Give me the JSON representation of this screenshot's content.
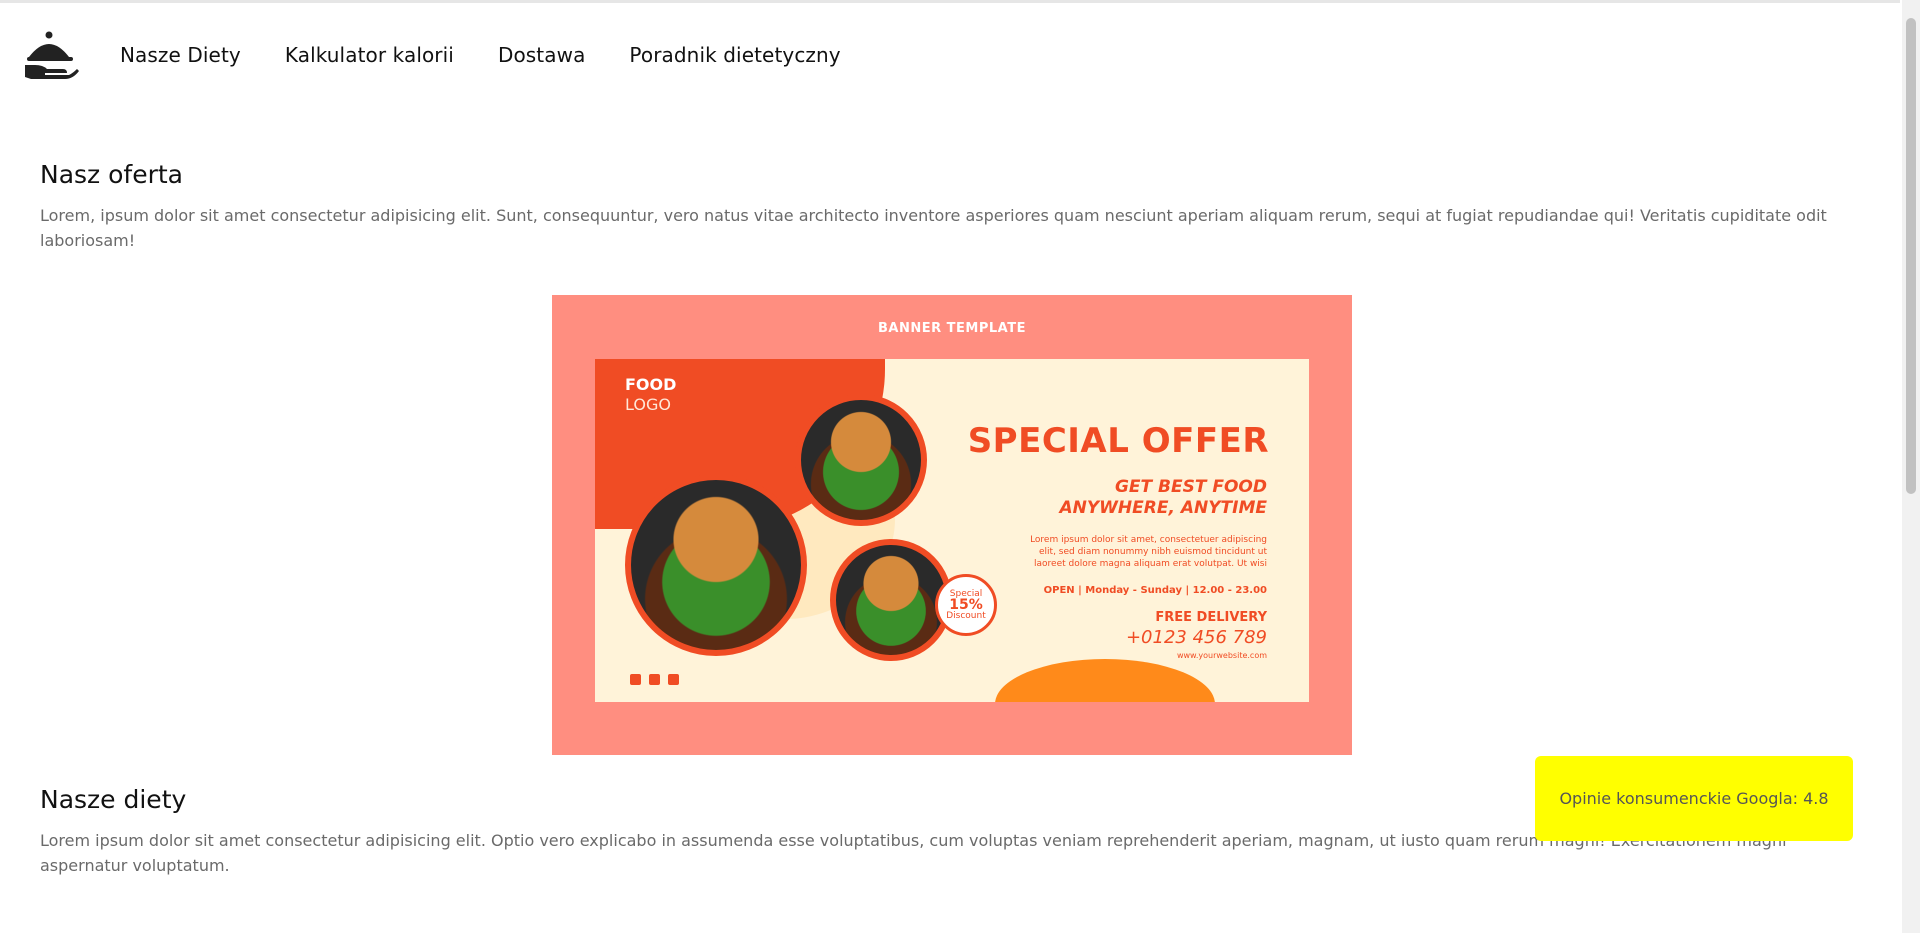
{
  "nav": {
    "items": [
      {
        "label": "Nasze Diety"
      },
      {
        "label": "Kalkulator kalorii"
      },
      {
        "label": "Dostawa"
      },
      {
        "label": "Poradnik dietetyczny"
      }
    ]
  },
  "offer": {
    "title": "Nasz oferta",
    "text": "Lorem, ipsum dolor sit amet consectetur adipisicing elit. Sunt, consequuntur, vero natus vitae architecto inventore asperiores quam nesciunt aperiam aliquam rerum, sequi at fugiat repudiandae qui! Veritatis cupiditate odit laboriosam!"
  },
  "banner": {
    "template_label": "BANNER TEMPLATE",
    "logo_line1": "FOOD",
    "logo_line2": "LOGO",
    "headline": "SPECIAL OFFER",
    "subheadline_line1": "GET BEST FOOD",
    "subheadline_line2": "ANYWHERE, ANYTIME",
    "body": "Lorem ipsum dolor sit amet, consectetuer adipiscing elit, sed diam nonummy nibh euismod tincidunt ut laoreet dolore magna aliquam erat volutpat. Ut wisi",
    "hours": "OPEN | Monday - Sunday | 12.00 - 23.00",
    "delivery": "FREE DELIVERY",
    "phone": "+0123 456 789",
    "website": "www.yourwebsite.com",
    "discount_small": "Special",
    "discount_value": "15%",
    "discount_label": "Discount",
    "colors": {
      "frame": "#ff8e80",
      "accent": "#f04c24",
      "cream": "#fff3d9",
      "orange": "#ff8a1a"
    }
  },
  "rating": {
    "text": "Opinie konsumenckie Googla: 4.8",
    "color": "#ffff00"
  },
  "diets": {
    "title": "Nasze diety",
    "text": "Lorem ipsum dolor sit amet consectetur adipisicing elit. Optio vero explicabo in assumenda esse voluptatibus, cum voluptas veniam reprehenderit aperiam, magnam, ut iusto quam rerum magni! Exercitationem magni aspernatur voluptatum."
  }
}
